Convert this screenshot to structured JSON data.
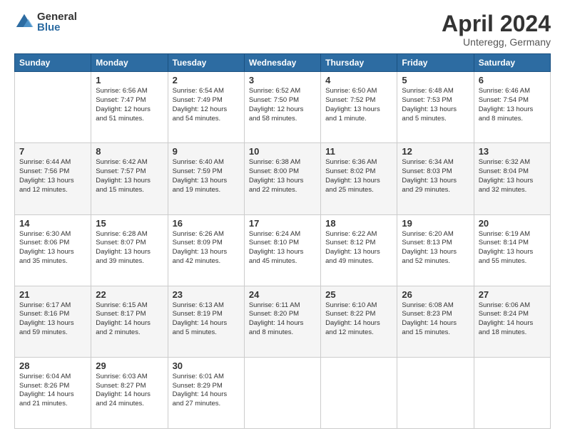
{
  "header": {
    "logo_general": "General",
    "logo_blue": "Blue",
    "month_title": "April 2024",
    "location": "Unteregg, Germany"
  },
  "weekdays": [
    "Sunday",
    "Monday",
    "Tuesday",
    "Wednesday",
    "Thursday",
    "Friday",
    "Saturday"
  ],
  "weeks": [
    [
      {
        "day": "",
        "info": ""
      },
      {
        "day": "1",
        "info": "Sunrise: 6:56 AM\nSunset: 7:47 PM\nDaylight: 12 hours\nand 51 minutes."
      },
      {
        "day": "2",
        "info": "Sunrise: 6:54 AM\nSunset: 7:49 PM\nDaylight: 12 hours\nand 54 minutes."
      },
      {
        "day": "3",
        "info": "Sunrise: 6:52 AM\nSunset: 7:50 PM\nDaylight: 12 hours\nand 58 minutes."
      },
      {
        "day": "4",
        "info": "Sunrise: 6:50 AM\nSunset: 7:52 PM\nDaylight: 13 hours\nand 1 minute."
      },
      {
        "day": "5",
        "info": "Sunrise: 6:48 AM\nSunset: 7:53 PM\nDaylight: 13 hours\nand 5 minutes."
      },
      {
        "day": "6",
        "info": "Sunrise: 6:46 AM\nSunset: 7:54 PM\nDaylight: 13 hours\nand 8 minutes."
      }
    ],
    [
      {
        "day": "7",
        "info": "Sunrise: 6:44 AM\nSunset: 7:56 PM\nDaylight: 13 hours\nand 12 minutes."
      },
      {
        "day": "8",
        "info": "Sunrise: 6:42 AM\nSunset: 7:57 PM\nDaylight: 13 hours\nand 15 minutes."
      },
      {
        "day": "9",
        "info": "Sunrise: 6:40 AM\nSunset: 7:59 PM\nDaylight: 13 hours\nand 19 minutes."
      },
      {
        "day": "10",
        "info": "Sunrise: 6:38 AM\nSunset: 8:00 PM\nDaylight: 13 hours\nand 22 minutes."
      },
      {
        "day": "11",
        "info": "Sunrise: 6:36 AM\nSunset: 8:02 PM\nDaylight: 13 hours\nand 25 minutes."
      },
      {
        "day": "12",
        "info": "Sunrise: 6:34 AM\nSunset: 8:03 PM\nDaylight: 13 hours\nand 29 minutes."
      },
      {
        "day": "13",
        "info": "Sunrise: 6:32 AM\nSunset: 8:04 PM\nDaylight: 13 hours\nand 32 minutes."
      }
    ],
    [
      {
        "day": "14",
        "info": "Sunrise: 6:30 AM\nSunset: 8:06 PM\nDaylight: 13 hours\nand 35 minutes."
      },
      {
        "day": "15",
        "info": "Sunrise: 6:28 AM\nSunset: 8:07 PM\nDaylight: 13 hours\nand 39 minutes."
      },
      {
        "day": "16",
        "info": "Sunrise: 6:26 AM\nSunset: 8:09 PM\nDaylight: 13 hours\nand 42 minutes."
      },
      {
        "day": "17",
        "info": "Sunrise: 6:24 AM\nSunset: 8:10 PM\nDaylight: 13 hours\nand 45 minutes."
      },
      {
        "day": "18",
        "info": "Sunrise: 6:22 AM\nSunset: 8:12 PM\nDaylight: 13 hours\nand 49 minutes."
      },
      {
        "day": "19",
        "info": "Sunrise: 6:20 AM\nSunset: 8:13 PM\nDaylight: 13 hours\nand 52 minutes."
      },
      {
        "day": "20",
        "info": "Sunrise: 6:19 AM\nSunset: 8:14 PM\nDaylight: 13 hours\nand 55 minutes."
      }
    ],
    [
      {
        "day": "21",
        "info": "Sunrise: 6:17 AM\nSunset: 8:16 PM\nDaylight: 13 hours\nand 59 minutes."
      },
      {
        "day": "22",
        "info": "Sunrise: 6:15 AM\nSunset: 8:17 PM\nDaylight: 14 hours\nand 2 minutes."
      },
      {
        "day": "23",
        "info": "Sunrise: 6:13 AM\nSunset: 8:19 PM\nDaylight: 14 hours\nand 5 minutes."
      },
      {
        "day": "24",
        "info": "Sunrise: 6:11 AM\nSunset: 8:20 PM\nDaylight: 14 hours\nand 8 minutes."
      },
      {
        "day": "25",
        "info": "Sunrise: 6:10 AM\nSunset: 8:22 PM\nDaylight: 14 hours\nand 12 minutes."
      },
      {
        "day": "26",
        "info": "Sunrise: 6:08 AM\nSunset: 8:23 PM\nDaylight: 14 hours\nand 15 minutes."
      },
      {
        "day": "27",
        "info": "Sunrise: 6:06 AM\nSunset: 8:24 PM\nDaylight: 14 hours\nand 18 minutes."
      }
    ],
    [
      {
        "day": "28",
        "info": "Sunrise: 6:04 AM\nSunset: 8:26 PM\nDaylight: 14 hours\nand 21 minutes."
      },
      {
        "day": "29",
        "info": "Sunrise: 6:03 AM\nSunset: 8:27 PM\nDaylight: 14 hours\nand 24 minutes."
      },
      {
        "day": "30",
        "info": "Sunrise: 6:01 AM\nSunset: 8:29 PM\nDaylight: 14 hours\nand 27 minutes."
      },
      {
        "day": "",
        "info": ""
      },
      {
        "day": "",
        "info": ""
      },
      {
        "day": "",
        "info": ""
      },
      {
        "day": "",
        "info": ""
      }
    ]
  ]
}
